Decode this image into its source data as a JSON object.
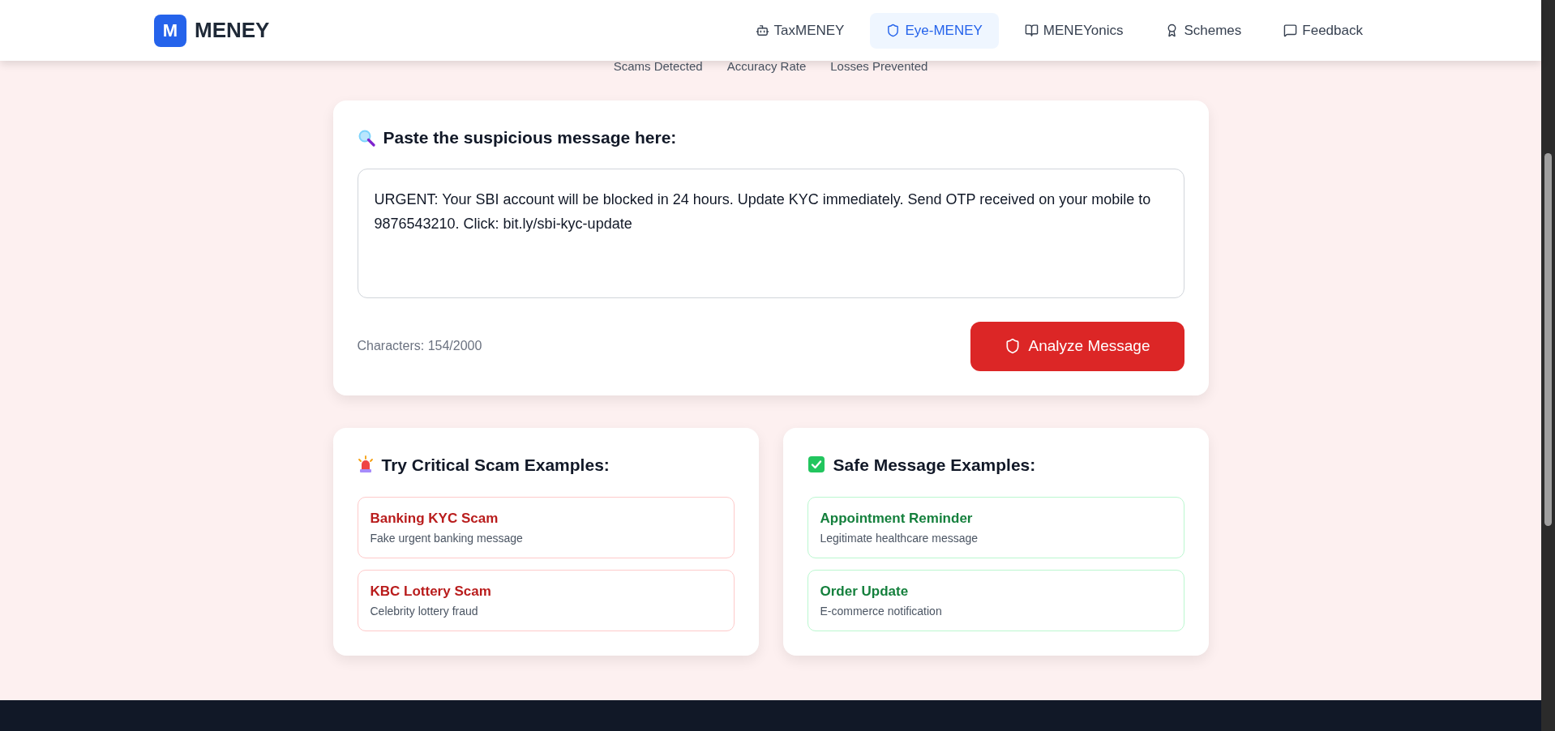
{
  "brand": {
    "mark": "M",
    "name": "MENEY"
  },
  "nav": [
    {
      "label": "TaxMENEY",
      "selected": false
    },
    {
      "label": "Eye-MENEY",
      "selected": true
    },
    {
      "label": "MENEYonics",
      "selected": false
    },
    {
      "label": "Schemes",
      "selected": false
    },
    {
      "label": "Feedback",
      "selected": false
    }
  ],
  "stats_labels": [
    "Scams Detected",
    "Accuracy Rate",
    "Losses Prevented"
  ],
  "analyzer": {
    "title": "Paste the suspicious message here:",
    "message": "URGENT: Your SBI account will be blocked in 24 hours. Update KYC immediately. Send OTP received on your mobile to 9876543210. Click: bit.ly/sbi-kyc-update",
    "counter": "Characters: 154/2000",
    "button": "Analyze Message"
  },
  "example_groups": [
    {
      "kind": "danger",
      "title": "Try Critical Scam Examples:",
      "items": [
        {
          "title": "Banking KYC Scam",
          "description": "Fake urgent banking message"
        },
        {
          "title": "KBC Lottery Scam",
          "description": "Celebrity lottery fraud"
        }
      ]
    },
    {
      "kind": "safe",
      "title": "Safe Message Examples:",
      "items": [
        {
          "title": "Appointment Reminder",
          "description": "Legitimate healthcare message"
        },
        {
          "title": "Order Update",
          "description": "E-commerce notification"
        }
      ]
    }
  ]
}
